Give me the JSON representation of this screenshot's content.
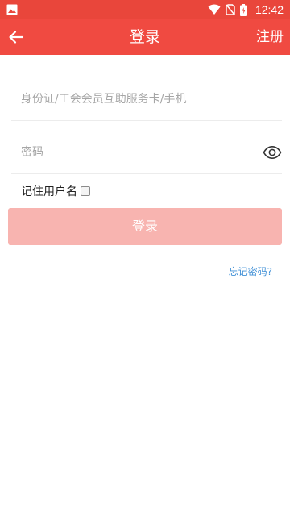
{
  "status_bar": {
    "time": "12:42",
    "icons": [
      "gallery-icon",
      "wifi-icon",
      "no-sim-icon",
      "battery-charging-icon"
    ]
  },
  "app_bar": {
    "title": "登录",
    "register_label": "注册",
    "back_icon": "arrow-left-icon"
  },
  "form": {
    "id_placeholder": "身份证/工会会员互助服务卡/手机",
    "id_value": "",
    "password_placeholder": "密码",
    "password_value": "",
    "remember_label": "记住用户名",
    "remember_checked": false,
    "login_label": "登录",
    "forgot_label": "忘记密码?"
  },
  "colors": {
    "status_bar": "#e9463b",
    "app_bar": "#f04a41",
    "login_button": "#f8b4b0",
    "forgot_link": "#3f8fd6"
  }
}
